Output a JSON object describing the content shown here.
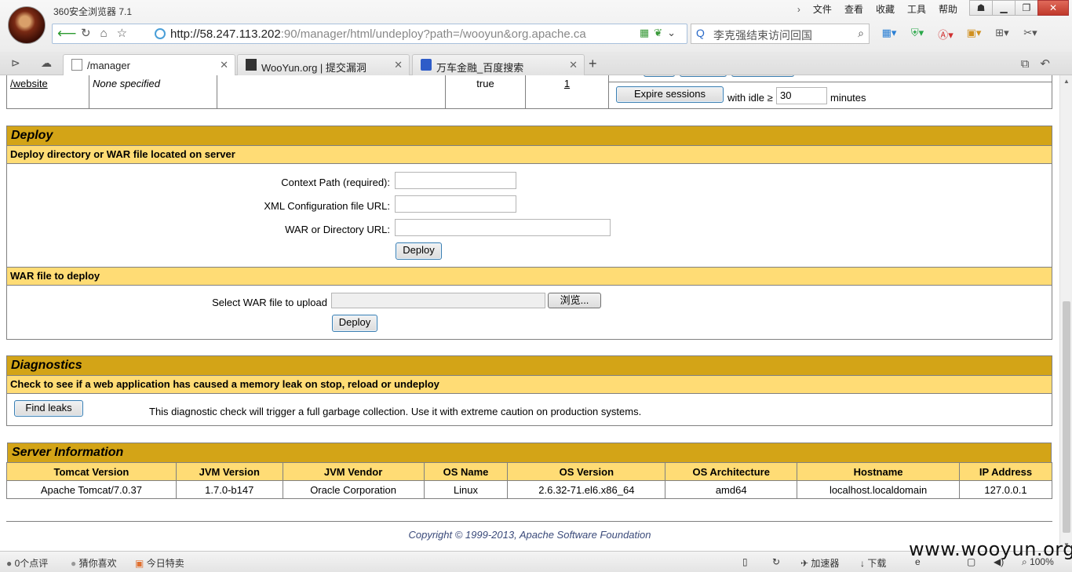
{
  "browser": {
    "window_title": "360安全浏览器 7.1",
    "menu": [
      "文件",
      "查看",
      "收藏",
      "工具",
      "帮助"
    ],
    "url_host": "http://58.247.113.202",
    "url_rest": ":90/manager/html/undeploy?path=/wooyun&org.apache.ca",
    "search_text": "李克强结束访问回国",
    "tabs": [
      {
        "label": "/manager",
        "icon": "page-icon",
        "active": true
      },
      {
        "label": "WooYun.org | 提交漏洞",
        "icon": "wooyun-icon",
        "active": false
      },
      {
        "label": "万车金融_百度搜索",
        "icon": "baidu-paw-icon",
        "active": false
      }
    ]
  },
  "app_row": {
    "path": "/website",
    "display_name": "None specified",
    "running": "true",
    "sessions": "1",
    "expire_button": "Expire sessions",
    "idle_prefix": "with idle ≥",
    "idle_value": "30",
    "idle_suffix": "minutes"
  },
  "deploy": {
    "title": "Deploy",
    "server_subtitle": "Deploy directory or WAR file located on server",
    "context_label": "Context Path (required):",
    "xml_label": "XML Configuration file URL:",
    "war_dir_label": "WAR or Directory URL:",
    "deploy_button": "Deploy",
    "war_subtitle": "WAR file to deploy",
    "select_label": "Select WAR file to upload",
    "browse_button": "浏览...",
    "upload_deploy_button": "Deploy"
  },
  "diagnostics": {
    "title": "Diagnostics",
    "subtitle": "Check to see if a web application has caused a memory leak on stop, reload or undeploy",
    "find_leaks_button": "Find leaks",
    "description": "This diagnostic check will trigger a full garbage collection. Use it with extreme caution on production systems."
  },
  "server_info": {
    "title": "Server Information",
    "headers": [
      "Tomcat Version",
      "JVM Version",
      "JVM Vendor",
      "OS Name",
      "OS Version",
      "OS Architecture",
      "Hostname",
      "IP Address"
    ],
    "values": [
      "Apache Tomcat/7.0.37",
      "1.7.0-b147",
      "Oracle Corporation",
      "Linux",
      "2.6.32-71.el6.x86_64",
      "amd64",
      "localhost.localdomain",
      "127.0.0.1"
    ]
  },
  "copyright": "Copyright © 1999-2013, Apache Software Foundation",
  "statusbar": {
    "comments": "0个点评",
    "guess": "猜你喜欢",
    "today_deal": "今日特卖",
    "accelerator": "加速器",
    "download": "下载",
    "zoom": "100%"
  },
  "watermark": "www.wooyun.org"
}
